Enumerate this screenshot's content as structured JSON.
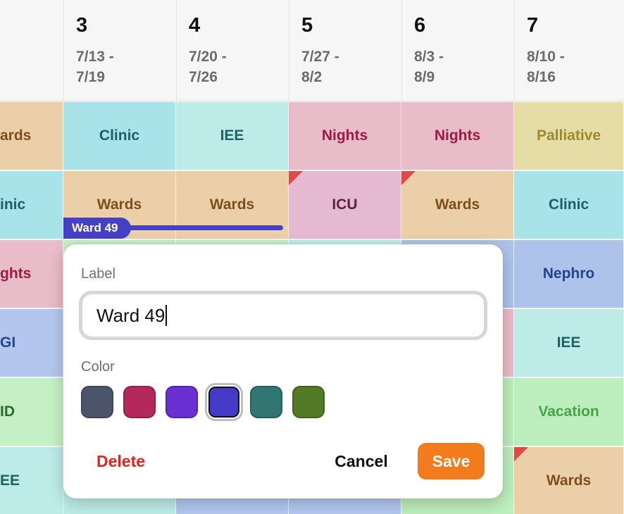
{
  "weeks": [
    {
      "num": "3",
      "range": "7/13 -\n7/19"
    },
    {
      "num": "4",
      "range": "7/20 -\n7/26"
    },
    {
      "num": "5",
      "range": "7/27 -\n8/2"
    },
    {
      "num": "6",
      "range": "8/3 -\n8/9"
    },
    {
      "num": "7",
      "range": "8/10 -\n8/16"
    }
  ],
  "grid": {
    "rows": [
      [
        {
          "label": "ards",
          "type": "wards"
        },
        {
          "label": "Clinic",
          "type": "clinic"
        },
        {
          "label": "IEE",
          "type": "iee"
        },
        {
          "label": "Nights",
          "type": "nights"
        },
        {
          "label": "Nights",
          "type": "nights"
        },
        {
          "label": "Palliative",
          "type": "palliative"
        }
      ],
      [
        {
          "label": "inic",
          "type": "clinic"
        },
        {
          "label": "Wards",
          "type": "wards"
        },
        {
          "label": "Wards",
          "type": "wards"
        },
        {
          "label": "ICU",
          "type": "icu",
          "flag": true
        },
        {
          "label": "Wards",
          "type": "wards",
          "flag": true
        },
        {
          "label": "Clinic",
          "type": "clinic"
        }
      ],
      [
        {
          "label": "ghts",
          "type": "nights"
        },
        {
          "label": "",
          "type": "id"
        },
        {
          "label": "",
          "type": "id"
        },
        {
          "label": "",
          "type": "iee"
        },
        {
          "label": "",
          "type": "nephro"
        },
        {
          "label": "Nephro",
          "type": "nephro"
        }
      ],
      [
        {
          "label": "GI",
          "type": "gi"
        },
        {
          "label": "",
          "type": "iee"
        },
        {
          "label": "",
          "type": "iee"
        },
        {
          "label": "",
          "type": "iee"
        },
        {
          "label": "",
          "type": "nights"
        },
        {
          "label": "IEE",
          "type": "iee"
        }
      ],
      [
        {
          "label": "ID",
          "type": "id"
        },
        {
          "label": "",
          "type": "id"
        },
        {
          "label": "",
          "type": "gi"
        },
        {
          "label": "",
          "type": "gi"
        },
        {
          "label": "",
          "type": "vacation"
        },
        {
          "label": "Vacation",
          "type": "vacation"
        }
      ],
      [
        {
          "label": "EE",
          "type": "iee"
        },
        {
          "label": "",
          "type": "iee"
        },
        {
          "label": "",
          "type": "gi"
        },
        {
          "label": "",
          "type": "gi"
        },
        {
          "label": "",
          "type": "vacation"
        },
        {
          "label": "Wards",
          "type": "wards",
          "flag": true
        }
      ]
    ]
  },
  "span": {
    "label": "Ward 49",
    "color": "#4540c4"
  },
  "popover": {
    "label_title": "Label",
    "label_value": "Ward 49",
    "color_title": "Color",
    "colors": [
      "#4b5468",
      "#b32a5a",
      "#692fd1",
      "#4539c8",
      "#317670",
      "#537a24"
    ],
    "selected_color": "#4539c8",
    "delete_label": "Delete",
    "cancel_label": "Cancel",
    "save_label": "Save"
  }
}
